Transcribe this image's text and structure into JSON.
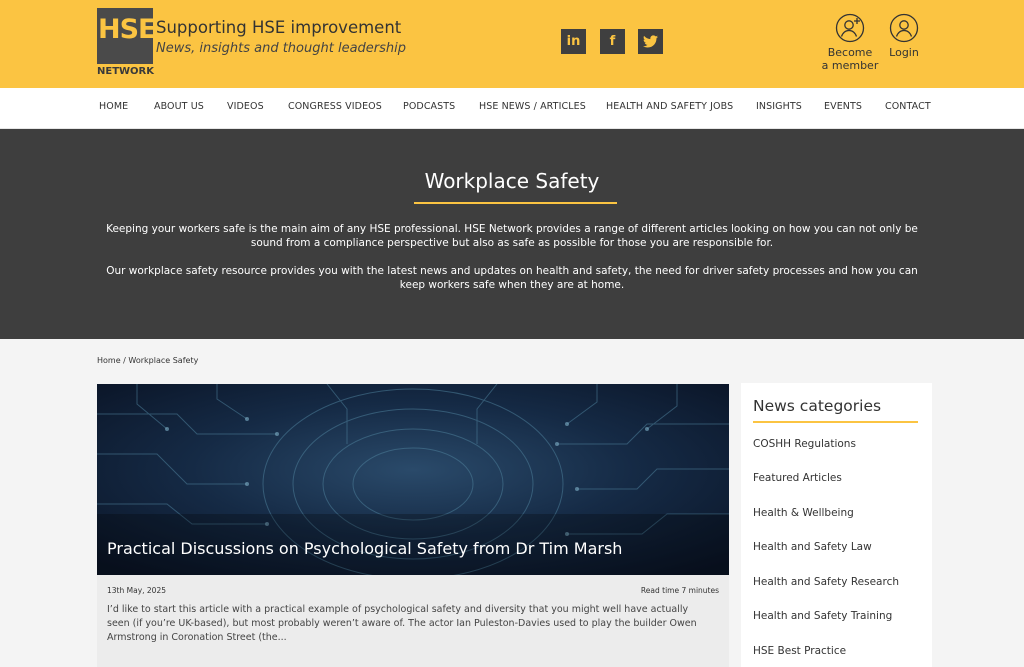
{
  "header": {
    "logo_text": "HSE",
    "logo_subtext": "NETWORK",
    "tagline_title": "Supporting HSE improvement",
    "tagline_subtitle": "News, insights and thought leadership",
    "social": {
      "linkedin": "in",
      "facebook": "f",
      "twitter": "twitter"
    },
    "become_member_line1": "Become",
    "become_member_line2": "a member",
    "login_label": "Login",
    "colors": {
      "brand_yellow": "#fbc442",
      "dark": "#3e3e3e"
    }
  },
  "nav": {
    "items": [
      {
        "label": "HOME"
      },
      {
        "label": "ABOUT US"
      },
      {
        "label": "VIDEOS"
      },
      {
        "label": "CONGRESS VIDEOS"
      },
      {
        "label": "PODCASTS"
      },
      {
        "label": "HSE NEWS / ARTICLES"
      },
      {
        "label": "HEALTH AND SAFETY JOBS"
      },
      {
        "label": "INSIGHTS"
      },
      {
        "label": "EVENTS"
      },
      {
        "label": "CONTACT"
      }
    ]
  },
  "hero": {
    "title": "Workplace Safety",
    "paragraph1": "Keeping your workers safe is the main aim of any HSE professional. HSE Network provides a range of different articles looking on how you can not only be sound from a compliance perspective but also as safe as possible for those you are responsible for.",
    "paragraph2": "Our workplace safety resource provides you with the latest news and updates on health and safety, the need for driver safety processes and how you can keep workers safe when they are at home."
  },
  "breadcrumb": "Home / Workplace Safety",
  "article": {
    "title": "Practical Discussions on Psychological Safety from Dr Tim Marsh",
    "date": "13th May, 2025",
    "read_time": "Read time 7 minutes",
    "excerpt": "I’d like to start this article with a practical example of psychological safety and diversity that you might well have actually seen (if you’re UK-based), but most probably weren’t aware of. The actor Ian Puleston-Davies used to play the builder Owen Armstrong in Coronation Street (the..."
  },
  "sidebar": {
    "title": "News categories",
    "items": [
      {
        "label": "COSHH Regulations"
      },
      {
        "label": "Featured Articles"
      },
      {
        "label": "Health & Wellbeing"
      },
      {
        "label": "Health and Safety Law"
      },
      {
        "label": "Health and Safety Research"
      },
      {
        "label": "Health and Safety Training"
      },
      {
        "label": "HSE Best Practice"
      }
    ]
  }
}
